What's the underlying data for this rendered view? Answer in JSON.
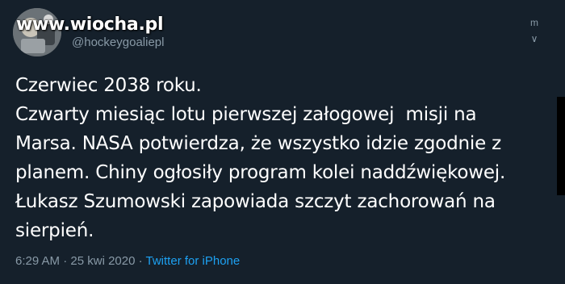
{
  "tweet": {
    "watermark": "www.wiocha.pl",
    "display_name": "",
    "username": "@hockeygoaliepl",
    "menu_glyph": "m ∨",
    "lines": [
      "Czerwiec 2038 roku.",
      "Czwarty miesiąc lotu pierwszej załogowej  misji na",
      "Marsa. NASA potwierdza, że wszystko idzie zgodnie z",
      "planem. Chiny ogłosiły program kolei naddźwiękowej.",
      "Łukasz Szumowski zapowiada szczyt zachorowań na",
      "sierpień."
    ],
    "time": "6:29 AM",
    "separator1": " · ",
    "date": "25 kwi 2020",
    "separator2": " · ",
    "source": "Twitter for iPhone"
  },
  "colors": {
    "background": "#15202b",
    "text": "#ffffff",
    "secondary": "#8899a6",
    "link": "#1da1f2"
  },
  "icons": {
    "menu": "chevron-down-icon",
    "avatar": "avatar-image"
  }
}
